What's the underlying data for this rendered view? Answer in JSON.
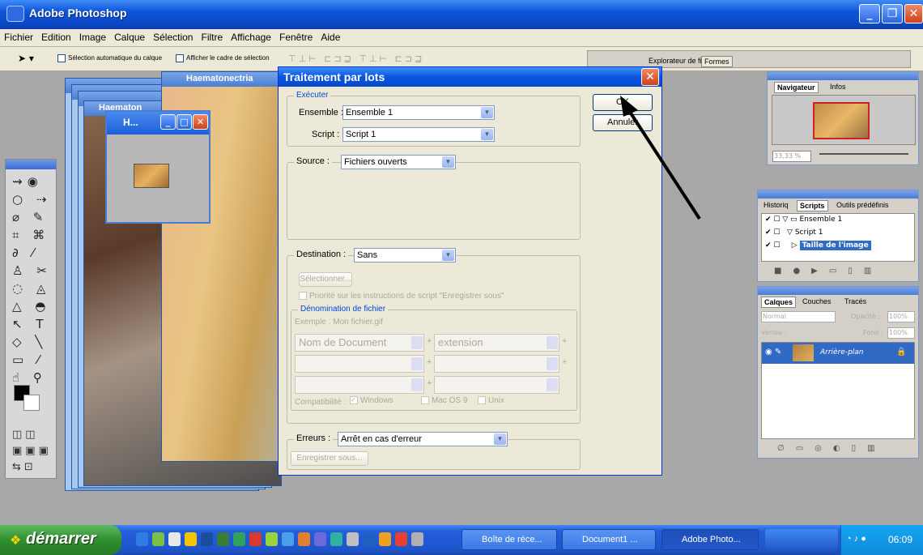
{
  "app": {
    "title": "Adobe Photoshop"
  },
  "menu": [
    "Fichier",
    "Edition",
    "Image",
    "Calque",
    "Sélection",
    "Filtre",
    "Affichage",
    "Fenêtre",
    "Aide"
  ],
  "options": {
    "auto_select": "Sélection automatique du calque",
    "show_bounds": "Afficher le cadre de sélection",
    "tab_folders": "Explorateur de fichiers",
    "tab_shapes": "Formes"
  },
  "docs": {
    "main": "Haematonectria",
    "second": "Haematon",
    "small": "H..."
  },
  "dialog": {
    "title": "Traitement par lots",
    "ok": "OK",
    "cancel": "Annuler",
    "execute": {
      "legend": "Exécuter",
      "set_label": "Ensemble :",
      "set_value": "Ensemble 1",
      "script_label": "Script :",
      "script_value": "Script 1"
    },
    "source": {
      "label": "Source :",
      "value": "Fichiers ouverts"
    },
    "destination": {
      "label": "Destination :",
      "value": "Sans",
      "choose": "Sélectionner...",
      "override": "Priorité sur les instructions de script \"Enregistrer sous\"",
      "naming": {
        "legend": "Dénomination de fichier",
        "example": "Exemple : Mon fichier.gif",
        "field1": "Nom de Document",
        "field2": "extension"
      },
      "compat_label": "Compatibilité :",
      "windows": "Windows",
      "mac": "Mac OS 9",
      "unix": "Unix"
    },
    "errors": {
      "label": "Erreurs :",
      "value": "Arrêt en cas d'erreur",
      "save_as": "Enregistrer sous..."
    }
  },
  "navigator": {
    "tab1": "Navigateur",
    "tab2": "Infos",
    "zoom": "33,33 %"
  },
  "actions": {
    "tab1": "Historiq",
    "tab2": "Scripts",
    "tab3": "Outils prédéfinis",
    "set": "Ensemble 1",
    "script": "Script 1",
    "step": "Taille de l'image"
  },
  "layers": {
    "tab1": "Calques",
    "tab2": "Couches",
    "tab3": "Tracés",
    "mode": "Normal",
    "opacity_label": "Opacité :",
    "opacity": "100%",
    "lock_label": "Verrou :",
    "fill_label": "Fond :",
    "fill": "100%",
    "layer_name": "Arrière-plan"
  },
  "taskbar": {
    "start": "démarrer",
    "items": [
      "Boîte de réce...",
      "Document1 ...",
      "Adobe Photo..."
    ],
    "clock": "06:09"
  }
}
